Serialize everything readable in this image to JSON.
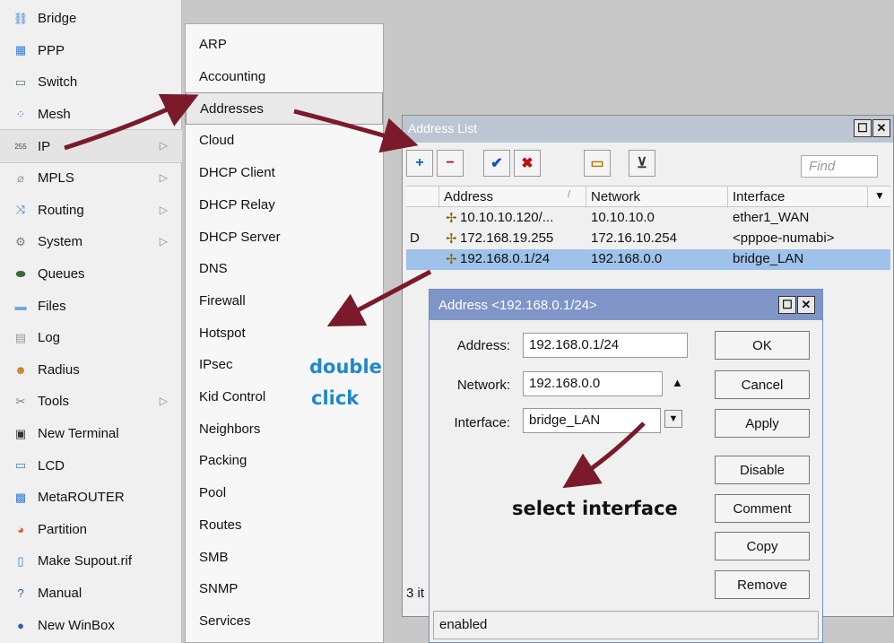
{
  "main_menu": [
    {
      "label": "Bridge",
      "icon": "bridge-icon",
      "glyph": "⛓",
      "color": "#3b7dd8",
      "submenu": false
    },
    {
      "label": "PPP",
      "icon": "ppp-icon",
      "glyph": "▦",
      "color": "#3b7dd8",
      "submenu": false
    },
    {
      "label": "Switch",
      "icon": "switch-icon",
      "glyph": "▭",
      "color": "#5a7a5a",
      "submenu": false
    },
    {
      "label": "Mesh",
      "icon": "mesh-icon",
      "glyph": "⁘",
      "color": "#3b7dd8",
      "submenu": false
    },
    {
      "label": "IP",
      "icon": "ip-icon",
      "glyph": "255",
      "color": "#444444",
      "submenu": true
    },
    {
      "label": "MPLS",
      "icon": "mpls-icon",
      "glyph": "⌀",
      "color": "#999999",
      "submenu": true
    },
    {
      "label": "Routing",
      "icon": "routing-icon",
      "glyph": "⤨",
      "color": "#3b7dd8",
      "submenu": true
    },
    {
      "label": "System",
      "icon": "system-gear-icon",
      "glyph": "⚙",
      "color": "#777777",
      "submenu": true
    },
    {
      "label": "Queues",
      "icon": "queues-icon",
      "glyph": "⬬",
      "color": "#3a6a3a",
      "submenu": false
    },
    {
      "label": "Files",
      "icon": "files-folder-icon",
      "glyph": "▬",
      "color": "#6fa8dc",
      "submenu": false
    },
    {
      "label": "Log",
      "icon": "log-icon",
      "glyph": "▤",
      "color": "#999999",
      "submenu": false
    },
    {
      "label": "Radius",
      "icon": "radius-users-icon",
      "glyph": "☻",
      "color": "#c08020",
      "submenu": false
    },
    {
      "label": "Tools",
      "icon": "tools-icon",
      "glyph": "✂",
      "color": "#777777",
      "submenu": true
    },
    {
      "label": "New Terminal",
      "icon": "terminal-icon",
      "glyph": "▣",
      "color": "#333333",
      "submenu": false
    },
    {
      "label": "LCD",
      "icon": "lcd-icon",
      "glyph": "▭",
      "color": "#3b7dd8",
      "submenu": false
    },
    {
      "label": "MetaROUTER",
      "icon": "metarouter-icon",
      "glyph": "▩",
      "color": "#3b7dd8",
      "submenu": false
    },
    {
      "label": "Partition",
      "icon": "partition-pie-icon",
      "glyph": "◕",
      "color": "#e05a2a",
      "submenu": false
    },
    {
      "label": "Make Supout.rif",
      "icon": "supout-file-icon",
      "glyph": "▯",
      "color": "#3b7dd8",
      "submenu": false
    },
    {
      "label": "Manual",
      "icon": "manual-help-icon",
      "glyph": "?",
      "color": "#2a5fb0",
      "submenu": false
    },
    {
      "label": "New WinBox",
      "icon": "winbox-icon",
      "glyph": "●",
      "color": "#2a5fb0",
      "submenu": false
    }
  ],
  "ip_submenu": [
    "ARP",
    "Accounting",
    "Addresses",
    "Cloud",
    "DHCP Client",
    "DHCP Relay",
    "DHCP Server",
    "DNS",
    "Firewall",
    "Hotspot",
    "IPsec",
    "Kid Control",
    "Neighbors",
    "Packing",
    "Pool",
    "Routes",
    "SMB",
    "SNMP",
    "Services"
  ],
  "address_list": {
    "title": "Address List",
    "find_placeholder": "Find",
    "toolbar": [
      {
        "name": "add-button",
        "glyph": "+",
        "color": "#1060c0"
      },
      {
        "name": "remove-button",
        "glyph": "−",
        "color": "#c01010"
      },
      {
        "name": "enable-button",
        "glyph": "✔",
        "color": "#1050b0"
      },
      {
        "name": "disable-button",
        "glyph": "✖",
        "color": "#c01010"
      },
      {
        "name": "comment-button",
        "glyph": "▭",
        "color": "#b08000"
      },
      {
        "name": "filter-button",
        "glyph": "⊻",
        "color": "#333333"
      }
    ],
    "columns": [
      "Address",
      "Network",
      "Interface"
    ],
    "rows": [
      {
        "flag": "",
        "address": "10.10.10.120/...",
        "network": "10.10.10.0",
        "interface": "ether1_WAN",
        "selected": false
      },
      {
        "flag": "D",
        "address": "172.168.19.255",
        "network": "172.16.10.254",
        "interface": "<pppoe-numabi>",
        "selected": false
      },
      {
        "flag": "",
        "address": "192.168.0.1/24",
        "network": "192.168.0.0",
        "interface": "bridge_LAN",
        "selected": true
      }
    ],
    "status": "3 it"
  },
  "address_dialog": {
    "title": "Address <192.168.0.1/24>",
    "address_label": "Address:",
    "address_value": "192.168.0.1/24",
    "network_label": "Network:",
    "network_value": "192.168.0.0",
    "interface_label": "Interface:",
    "interface_value": "bridge_LAN",
    "buttons": [
      "OK",
      "Cancel",
      "Apply",
      "Disable",
      "Comment",
      "Copy",
      "Remove"
    ],
    "status": "enabled"
  },
  "annotations": {
    "double_line1": "double",
    "double_line2": "click",
    "select_interface": "select interface",
    "arrow_color": "#7a1a2a",
    "blue": "#1e88cf"
  }
}
